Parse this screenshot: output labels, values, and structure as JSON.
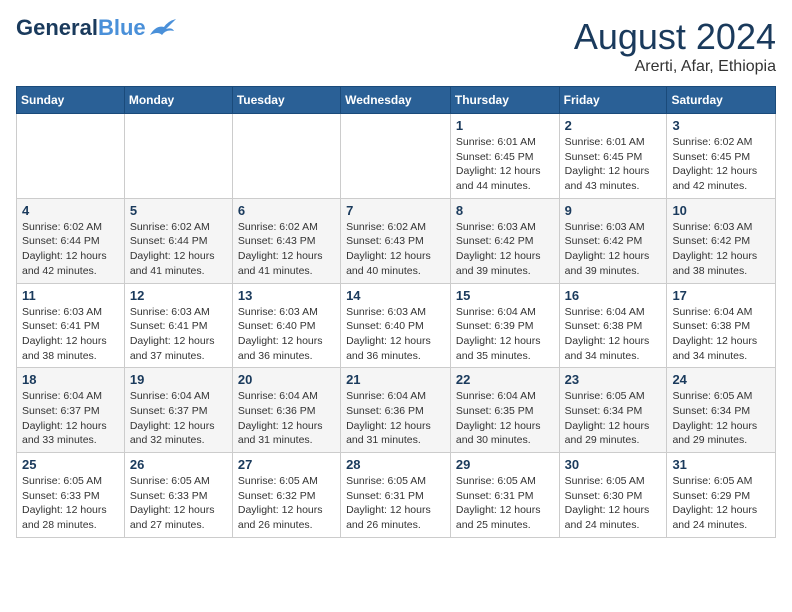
{
  "header": {
    "logo_line1": "General",
    "logo_line2": "Blue",
    "month": "August 2024",
    "location": "Arerti, Afar, Ethiopia"
  },
  "days_of_week": [
    "Sunday",
    "Monday",
    "Tuesday",
    "Wednesday",
    "Thursday",
    "Friday",
    "Saturday"
  ],
  "weeks": [
    [
      {
        "num": "",
        "detail": ""
      },
      {
        "num": "",
        "detail": ""
      },
      {
        "num": "",
        "detail": ""
      },
      {
        "num": "",
        "detail": ""
      },
      {
        "num": "1",
        "detail": "Sunrise: 6:01 AM\nSunset: 6:45 PM\nDaylight: 12 hours\nand 44 minutes."
      },
      {
        "num": "2",
        "detail": "Sunrise: 6:01 AM\nSunset: 6:45 PM\nDaylight: 12 hours\nand 43 minutes."
      },
      {
        "num": "3",
        "detail": "Sunrise: 6:02 AM\nSunset: 6:45 PM\nDaylight: 12 hours\nand 42 minutes."
      }
    ],
    [
      {
        "num": "4",
        "detail": "Sunrise: 6:02 AM\nSunset: 6:44 PM\nDaylight: 12 hours\nand 42 minutes."
      },
      {
        "num": "5",
        "detail": "Sunrise: 6:02 AM\nSunset: 6:44 PM\nDaylight: 12 hours\nand 41 minutes."
      },
      {
        "num": "6",
        "detail": "Sunrise: 6:02 AM\nSunset: 6:43 PM\nDaylight: 12 hours\nand 41 minutes."
      },
      {
        "num": "7",
        "detail": "Sunrise: 6:02 AM\nSunset: 6:43 PM\nDaylight: 12 hours\nand 40 minutes."
      },
      {
        "num": "8",
        "detail": "Sunrise: 6:03 AM\nSunset: 6:42 PM\nDaylight: 12 hours\nand 39 minutes."
      },
      {
        "num": "9",
        "detail": "Sunrise: 6:03 AM\nSunset: 6:42 PM\nDaylight: 12 hours\nand 39 minutes."
      },
      {
        "num": "10",
        "detail": "Sunrise: 6:03 AM\nSunset: 6:42 PM\nDaylight: 12 hours\nand 38 minutes."
      }
    ],
    [
      {
        "num": "11",
        "detail": "Sunrise: 6:03 AM\nSunset: 6:41 PM\nDaylight: 12 hours\nand 38 minutes."
      },
      {
        "num": "12",
        "detail": "Sunrise: 6:03 AM\nSunset: 6:41 PM\nDaylight: 12 hours\nand 37 minutes."
      },
      {
        "num": "13",
        "detail": "Sunrise: 6:03 AM\nSunset: 6:40 PM\nDaylight: 12 hours\nand 36 minutes."
      },
      {
        "num": "14",
        "detail": "Sunrise: 6:03 AM\nSunset: 6:40 PM\nDaylight: 12 hours\nand 36 minutes."
      },
      {
        "num": "15",
        "detail": "Sunrise: 6:04 AM\nSunset: 6:39 PM\nDaylight: 12 hours\nand 35 minutes."
      },
      {
        "num": "16",
        "detail": "Sunrise: 6:04 AM\nSunset: 6:38 PM\nDaylight: 12 hours\nand 34 minutes."
      },
      {
        "num": "17",
        "detail": "Sunrise: 6:04 AM\nSunset: 6:38 PM\nDaylight: 12 hours\nand 34 minutes."
      }
    ],
    [
      {
        "num": "18",
        "detail": "Sunrise: 6:04 AM\nSunset: 6:37 PM\nDaylight: 12 hours\nand 33 minutes."
      },
      {
        "num": "19",
        "detail": "Sunrise: 6:04 AM\nSunset: 6:37 PM\nDaylight: 12 hours\nand 32 minutes."
      },
      {
        "num": "20",
        "detail": "Sunrise: 6:04 AM\nSunset: 6:36 PM\nDaylight: 12 hours\nand 31 minutes."
      },
      {
        "num": "21",
        "detail": "Sunrise: 6:04 AM\nSunset: 6:36 PM\nDaylight: 12 hours\nand 31 minutes."
      },
      {
        "num": "22",
        "detail": "Sunrise: 6:04 AM\nSunset: 6:35 PM\nDaylight: 12 hours\nand 30 minutes."
      },
      {
        "num": "23",
        "detail": "Sunrise: 6:05 AM\nSunset: 6:34 PM\nDaylight: 12 hours\nand 29 minutes."
      },
      {
        "num": "24",
        "detail": "Sunrise: 6:05 AM\nSunset: 6:34 PM\nDaylight: 12 hours\nand 29 minutes."
      }
    ],
    [
      {
        "num": "25",
        "detail": "Sunrise: 6:05 AM\nSunset: 6:33 PM\nDaylight: 12 hours\nand 28 minutes."
      },
      {
        "num": "26",
        "detail": "Sunrise: 6:05 AM\nSunset: 6:33 PM\nDaylight: 12 hours\nand 27 minutes."
      },
      {
        "num": "27",
        "detail": "Sunrise: 6:05 AM\nSunset: 6:32 PM\nDaylight: 12 hours\nand 26 minutes."
      },
      {
        "num": "28",
        "detail": "Sunrise: 6:05 AM\nSunset: 6:31 PM\nDaylight: 12 hours\nand 26 minutes."
      },
      {
        "num": "29",
        "detail": "Sunrise: 6:05 AM\nSunset: 6:31 PM\nDaylight: 12 hours\nand 25 minutes."
      },
      {
        "num": "30",
        "detail": "Sunrise: 6:05 AM\nSunset: 6:30 PM\nDaylight: 12 hours\nand 24 minutes."
      },
      {
        "num": "31",
        "detail": "Sunrise: 6:05 AM\nSunset: 6:29 PM\nDaylight: 12 hours\nand 24 minutes."
      }
    ]
  ]
}
